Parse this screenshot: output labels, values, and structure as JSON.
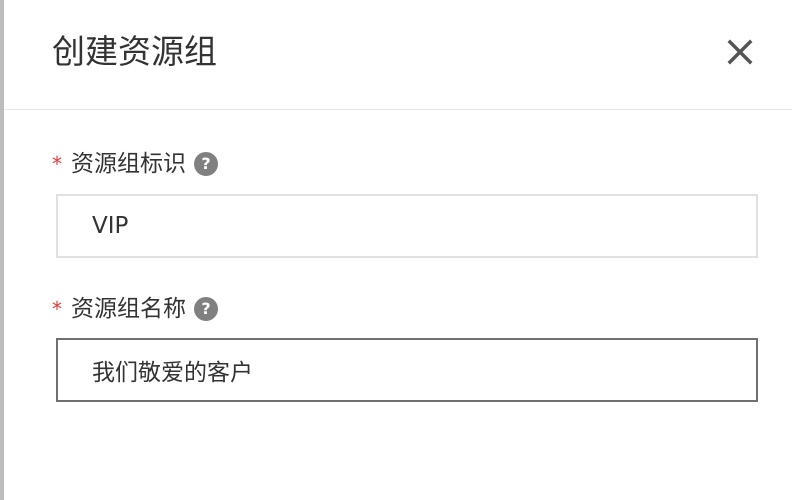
{
  "dialog": {
    "title": "创建资源组",
    "close_icon": "close-icon"
  },
  "form": {
    "fields": [
      {
        "required_mark": "*",
        "label": "资源组标识",
        "help_symbol": "?",
        "value": "VIP"
      },
      {
        "required_mark": "*",
        "label": "资源组名称",
        "help_symbol": "?",
        "value": "我们敬爱的客户"
      }
    ]
  },
  "colors": {
    "required": "#e53935",
    "help_icon": "#808080",
    "text": "#333333",
    "active_border": "#707070",
    "inactive_border": "#e1e1e1",
    "divider": "#e8e8e8"
  }
}
